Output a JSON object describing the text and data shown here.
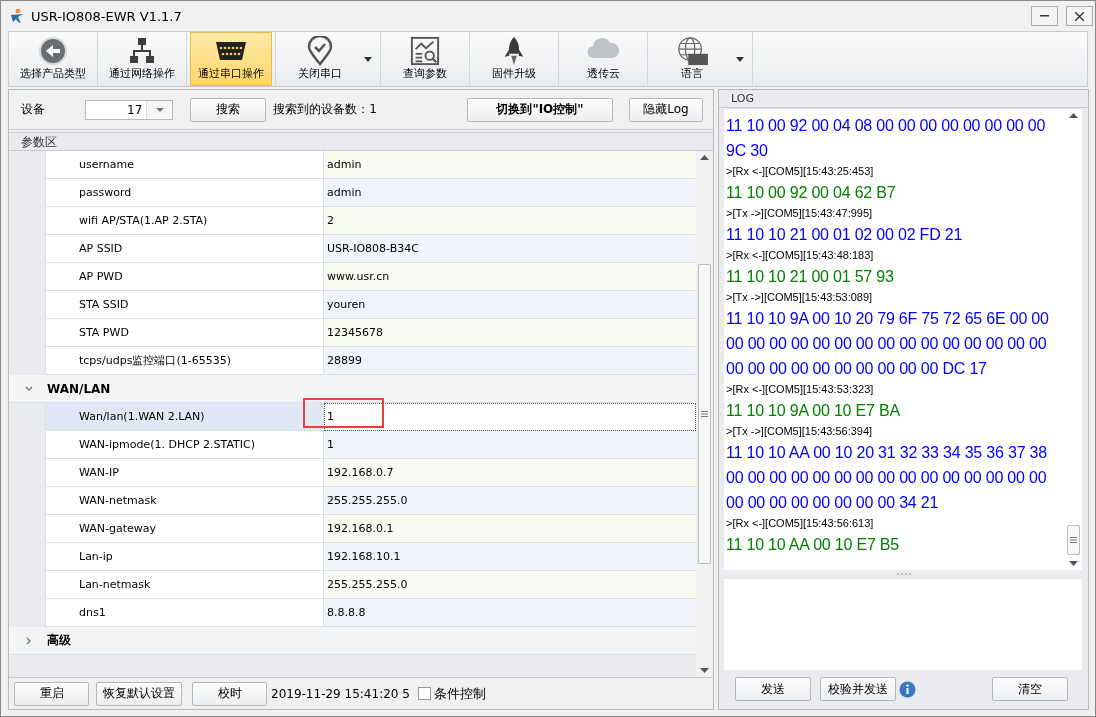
{
  "window": {
    "title": "USR-IO808-EWR V1.1.7"
  },
  "toolbar": [
    {
      "label": "选择产品类型",
      "selected": false,
      "dropdown": false
    },
    {
      "label": "通过网络操作",
      "selected": false,
      "dropdown": false
    },
    {
      "label": "通过串口操作",
      "selected": true,
      "dropdown": false
    },
    {
      "label": "关闭串口",
      "selected": false,
      "dropdown": true
    },
    {
      "label": "查询参数",
      "selected": false,
      "dropdown": false
    },
    {
      "label": "固件升级",
      "selected": false,
      "dropdown": false
    },
    {
      "label": "透传云",
      "selected": false,
      "dropdown": false
    },
    {
      "label": "语言",
      "selected": false,
      "dropdown": true
    }
  ],
  "device_bar": {
    "device_label": "设备",
    "device_value": "17",
    "search_button": "搜索",
    "found_text": "搜索到的设备数：1",
    "switch_button": "切换到\"IO控制\"",
    "hide_log_button": "隐藏Log"
  },
  "params": {
    "title": "参数区",
    "groups": [
      {
        "rows": [
          {
            "name": "username",
            "value": "admin",
            "selected": false
          },
          {
            "name": "password",
            "value": "admin",
            "selected": false
          },
          {
            "name": "wifi AP/STA(1.AP 2.STA)",
            "value": "2",
            "selected": false
          },
          {
            "name": "AP SSID",
            "value": "USR-IO808-B34C",
            "selected": false
          },
          {
            "name": "AP PWD",
            "value": "www.usr.cn",
            "selected": false
          },
          {
            "name": "STA SSID",
            "value": "youren",
            "selected": false
          },
          {
            "name": "STA PWD",
            "value": "12345678",
            "selected": false
          },
          {
            "name": "tcps/udps监控端口(1-65535)",
            "value": "28899",
            "selected": false
          }
        ]
      },
      {
        "title": "WAN/LAN",
        "expanded": true,
        "rows": [
          {
            "name": "Wan/lan(1.WAN 2.LAN)",
            "value": "1",
            "selected": true
          },
          {
            "name": "WAN-ipmode(1. DHCP 2.STATIC)",
            "value": "1",
            "selected": false
          },
          {
            "name": "WAN-IP",
            "value": "192.168.0.7",
            "selected": false
          },
          {
            "name": "WAN-netmask",
            "value": "255.255.255.0",
            "selected": false
          },
          {
            "name": "WAN-gateway",
            "value": "192.168.0.1",
            "selected": false
          },
          {
            "name": "Lan-ip",
            "value": "192.168.10.1",
            "selected": false
          },
          {
            "name": "Lan-netmask",
            "value": "255.255.255.0",
            "selected": false
          },
          {
            "name": "dns1",
            "value": "8.8.8.8",
            "selected": false
          }
        ]
      },
      {
        "title": "高级",
        "expanded": false
      }
    ]
  },
  "bottom_bar": {
    "buttons": [
      "重启",
      "恢复默认设置",
      "校时"
    ],
    "time": "2019-11-29 15:41:20 5",
    "condition_checkbox": {
      "label": "条件控制",
      "checked": false
    }
  },
  "log": {
    "title": "LOG",
    "entries": [
      {
        "kind": "data",
        "color": "#0000ff",
        "text": "11 10 00 92 00 04 08 00 00 00 00 00 00 00 00 9C 30"
      },
      {
        "kind": "header",
        "text": ">[Rx <-][COM5][15:43:25:453]"
      },
      {
        "kind": "data",
        "color": "#008000",
        "text": "11 10 00 92 00 04 62 B7"
      },
      {
        "kind": "header",
        "text": ">[Tx ->][COM5][15:43:47:995]"
      },
      {
        "kind": "data",
        "color": "#0000ff",
        "text": "11 10 10 21 00 01 02 00 02 FD 21"
      },
      {
        "kind": "header",
        "text": ">[Rx <-][COM5][15:43:48:183]"
      },
      {
        "kind": "data",
        "color": "#008000",
        "text": "11 10 10 21 00 01 57 93"
      },
      {
        "kind": "header",
        "text": ">[Tx ->][COM5][15:43:53:089]"
      },
      {
        "kind": "data",
        "color": "#0000ff",
        "text": "11 10 10 9A 00 10 20 79 6F 75 72 65 6E 00 00 00 00 00 00 00 00 00 00 00 00 00 00 00 00 00 00 00 00 00 00 00 00 00 00 00 DC 17"
      },
      {
        "kind": "header",
        "text": ">[Rx <-][COM5][15:43:53:323]"
      },
      {
        "kind": "data",
        "color": "#008000",
        "text": "11 10 10 9A 00 10 E7 BA"
      },
      {
        "kind": "header",
        "text": ">[Tx ->][COM5][15:43:56:394]"
      },
      {
        "kind": "data",
        "color": "#0000ff",
        "text": "11 10 10 AA 00 10 20 31 32 33 34 35 36 37 38 00 00 00 00 00 00 00 00 00 00 00 00 00 00 00 00 00 00 00 00 00 00 00 34 21"
      },
      {
        "kind": "header",
        "text": ">[Rx <-][COM5][15:43:56:613]"
      },
      {
        "kind": "data",
        "color": "#008000",
        "text": "11 10 10 AA 00 10 E7 B5"
      }
    ],
    "buttons": [
      "发送",
      "校验并发送",
      "清空"
    ]
  }
}
